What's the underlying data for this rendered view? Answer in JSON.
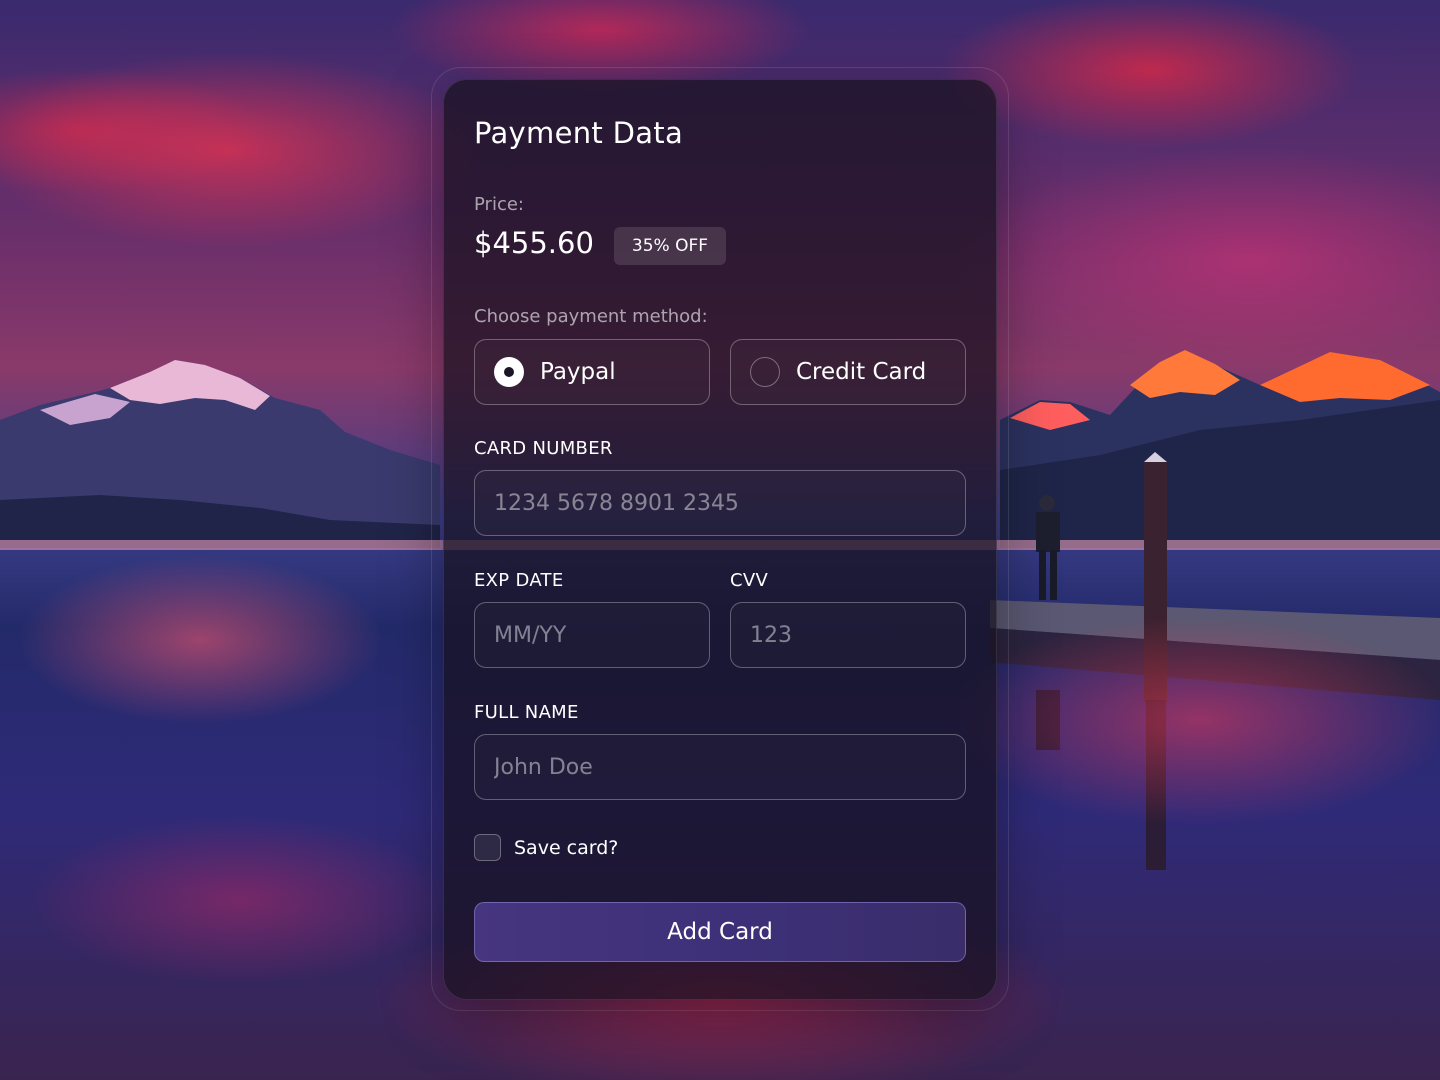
{
  "form": {
    "title": "Payment Data",
    "price_label": "Price:",
    "price": "$455.60",
    "discount_badge": "35% OFF",
    "method_label": "Choose payment method:",
    "methods": [
      {
        "label": "Paypal",
        "selected": true
      },
      {
        "label": "Credit Card",
        "selected": false
      }
    ],
    "card_number": {
      "label": "CARD NUMBER",
      "placeholder": "1234 5678 8901 2345",
      "value": ""
    },
    "exp_date": {
      "label": "EXP DATE",
      "placeholder": "MM/YY",
      "value": ""
    },
    "cvv": {
      "label": "CVV",
      "placeholder": "123",
      "value": ""
    },
    "full_name": {
      "label": "FULL NAME",
      "placeholder": "John Doe",
      "value": ""
    },
    "save_card": {
      "label": "Save card?",
      "checked": false
    },
    "submit_label": "Add Card"
  },
  "colors": {
    "accent": "#46357f",
    "card_background": "#16101e",
    "text": "#ffffff"
  }
}
